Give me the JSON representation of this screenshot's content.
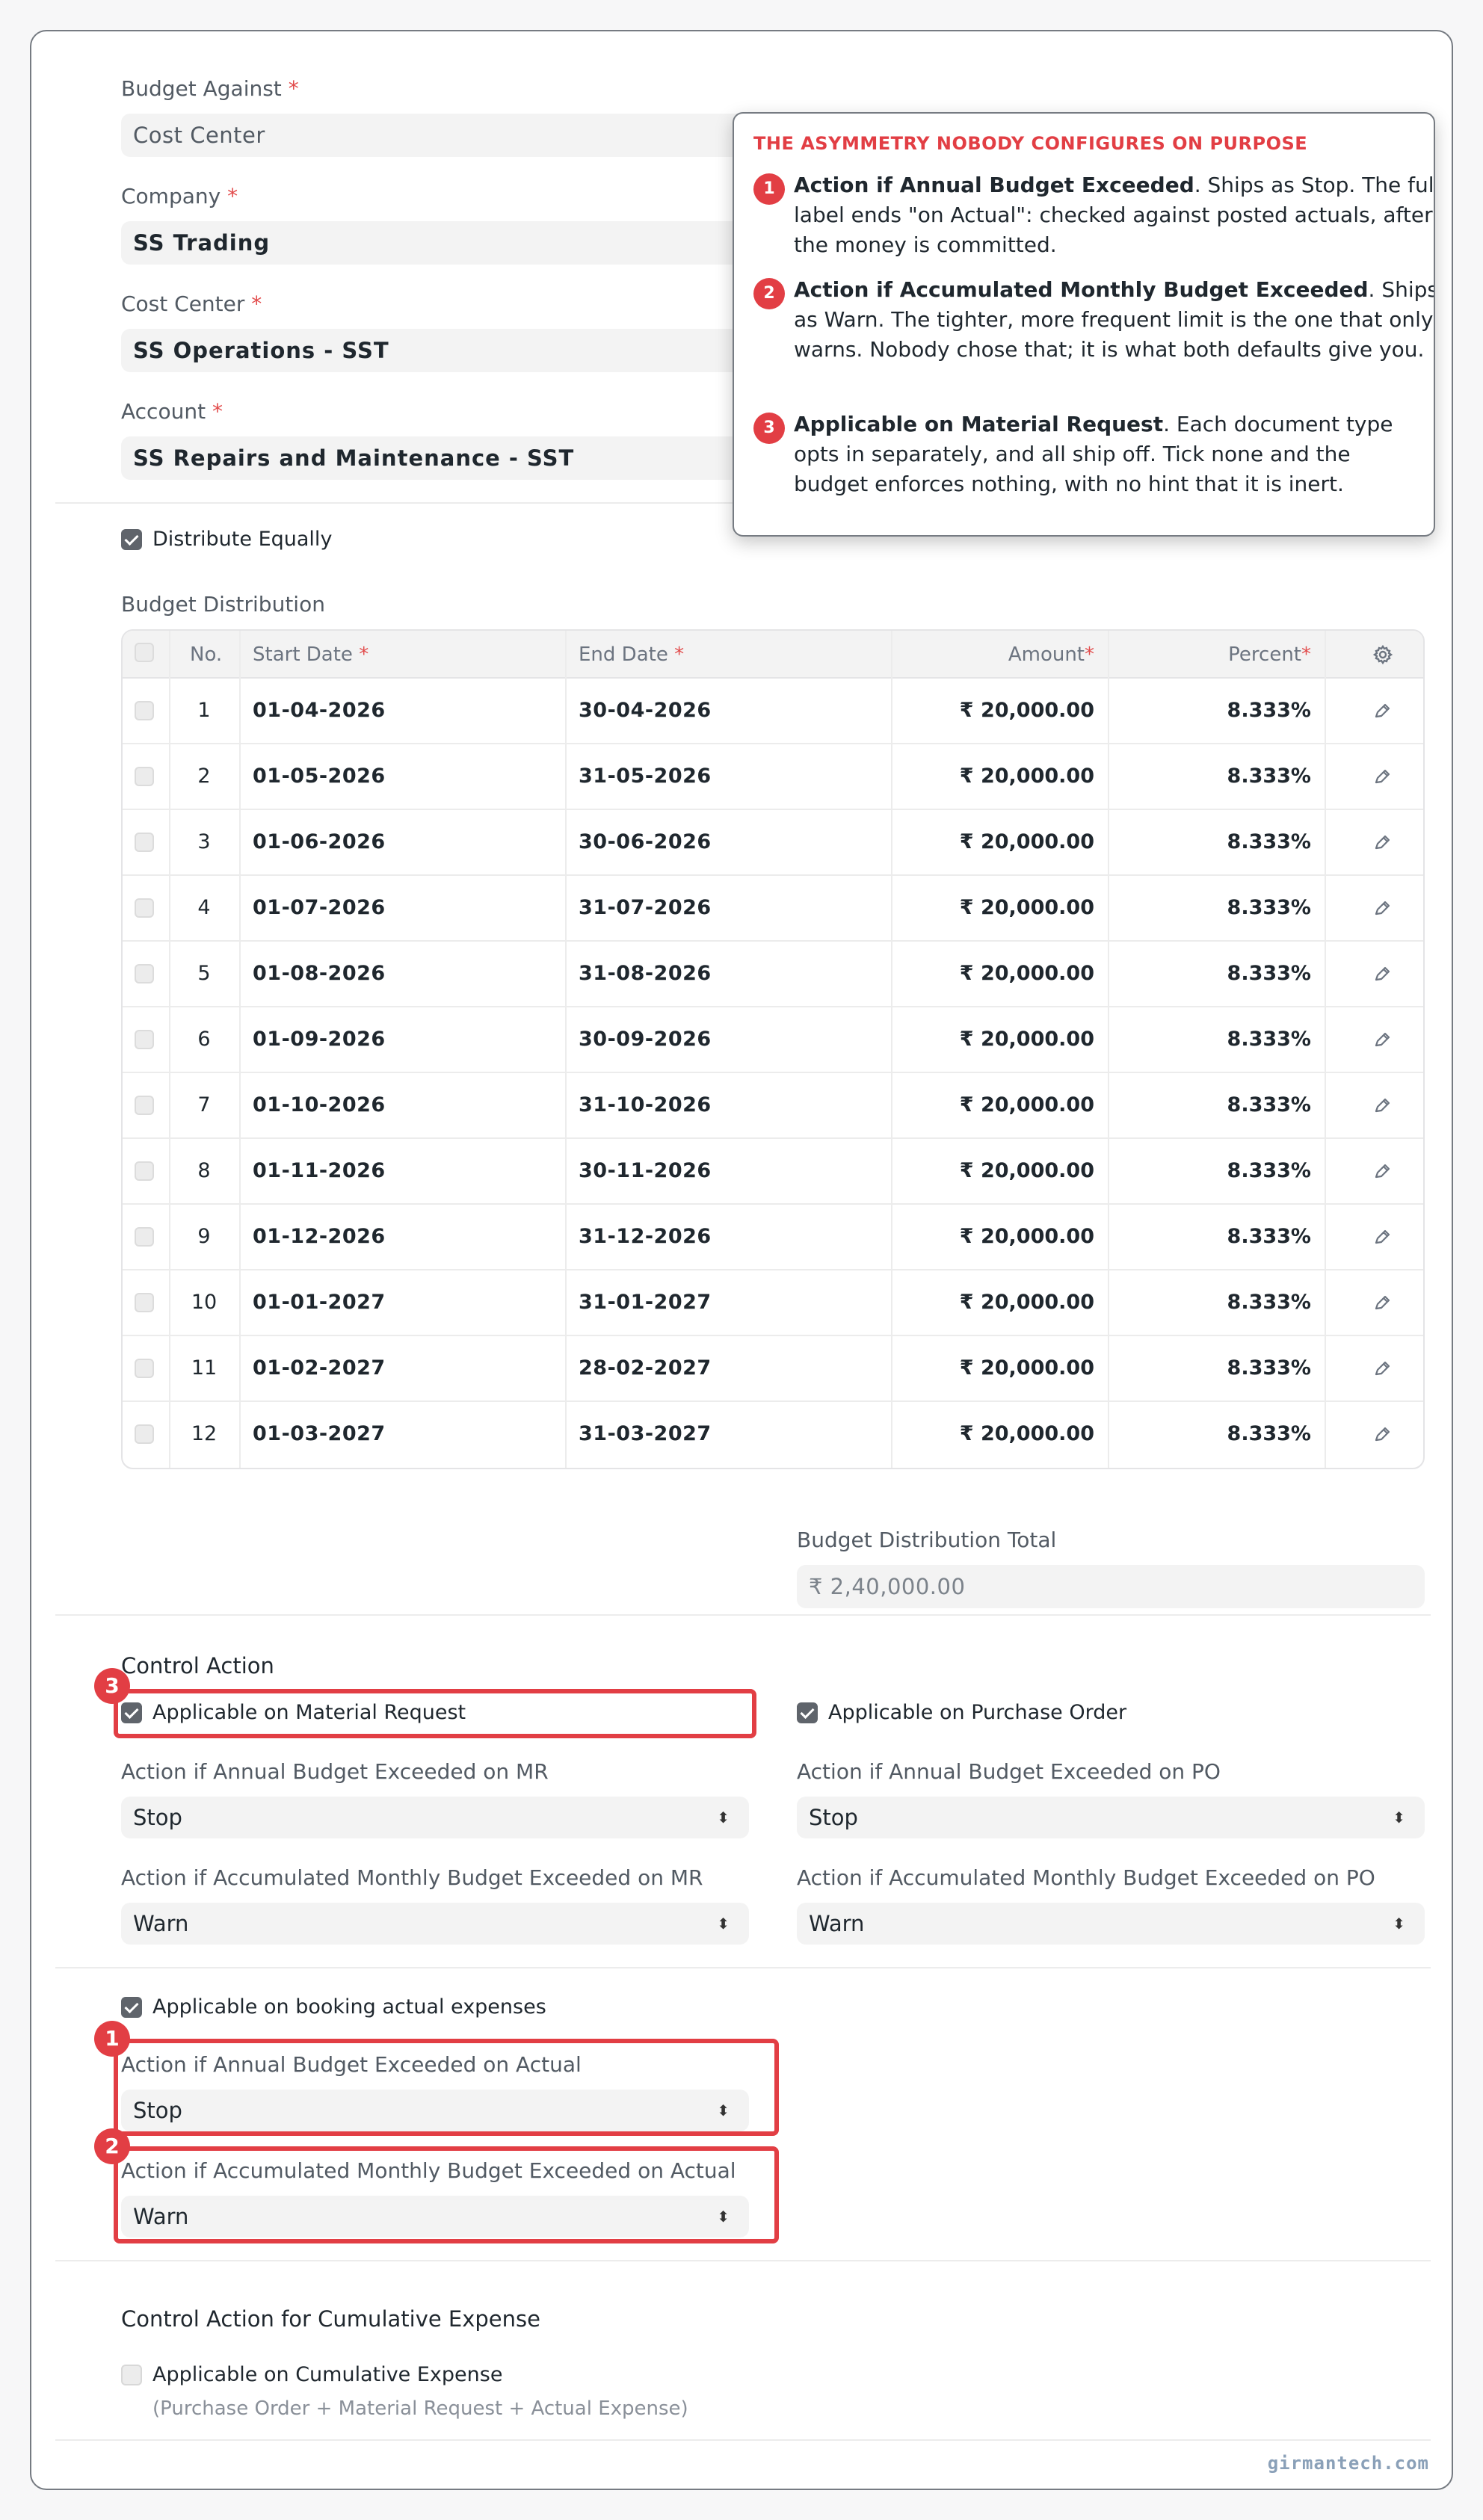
{
  "fields": {
    "budget_against": {
      "label": "Budget Against",
      "value": "Cost Center"
    },
    "company": {
      "label": "Company",
      "value": "SS Trading"
    },
    "cost_center": {
      "label": "Cost Center",
      "value": "SS Operations - SST"
    },
    "account": {
      "label": "Account",
      "value": "SS Repairs and Maintenance - SST"
    },
    "required_mark": "*"
  },
  "distribute_equally": {
    "label": "Distribute Equally",
    "checked": true
  },
  "budget_distribution": {
    "title": "Budget Distribution",
    "columns": {
      "no": "No.",
      "start_date": "Start Date",
      "end_date": "End Date",
      "amount": "Amount",
      "percent": "Percent"
    },
    "rows": [
      {
        "no": "1",
        "start": "01-04-2026",
        "end": "30-04-2026",
        "amount": "₹ 20,000.00",
        "percent": "8.333%"
      },
      {
        "no": "2",
        "start": "01-05-2026",
        "end": "31-05-2026",
        "amount": "₹ 20,000.00",
        "percent": "8.333%"
      },
      {
        "no": "3",
        "start": "01-06-2026",
        "end": "30-06-2026",
        "amount": "₹ 20,000.00",
        "percent": "8.333%"
      },
      {
        "no": "4",
        "start": "01-07-2026",
        "end": "31-07-2026",
        "amount": "₹ 20,000.00",
        "percent": "8.333%"
      },
      {
        "no": "5",
        "start": "01-08-2026",
        "end": "31-08-2026",
        "amount": "₹ 20,000.00",
        "percent": "8.333%"
      },
      {
        "no": "6",
        "start": "01-09-2026",
        "end": "30-09-2026",
        "amount": "₹ 20,000.00",
        "percent": "8.333%"
      },
      {
        "no": "7",
        "start": "01-10-2026",
        "end": "31-10-2026",
        "amount": "₹ 20,000.00",
        "percent": "8.333%"
      },
      {
        "no": "8",
        "start": "01-11-2026",
        "end": "30-11-2026",
        "amount": "₹ 20,000.00",
        "percent": "8.333%"
      },
      {
        "no": "9",
        "start": "01-12-2026",
        "end": "31-12-2026",
        "amount": "₹ 20,000.00",
        "percent": "8.333%"
      },
      {
        "no": "10",
        "start": "01-01-2027",
        "end": "31-01-2027",
        "amount": "₹ 20,000.00",
        "percent": "8.333%"
      },
      {
        "no": "11",
        "start": "01-02-2027",
        "end": "28-02-2027",
        "amount": "₹ 20,000.00",
        "percent": "8.333%"
      },
      {
        "no": "12",
        "start": "01-03-2027",
        "end": "31-03-2027",
        "amount": "₹ 20,000.00",
        "percent": "8.333%"
      }
    ],
    "total_label": "Budget Distribution Total",
    "total_value": "₹ 2,40,000.00"
  },
  "control_action": {
    "title": "Control Action",
    "mr_checkbox": {
      "label": "Applicable on Material Request",
      "checked": true
    },
    "po_checkbox": {
      "label": "Applicable on Purchase Order",
      "checked": true
    },
    "annual_mr": {
      "label": "Action if Annual Budget Exceeded on MR",
      "value": "Stop"
    },
    "annual_po": {
      "label": "Action if Annual Budget Exceeded on PO",
      "value": "Stop"
    },
    "monthly_mr": {
      "label": "Action if Accumulated Monthly Budget Exceeded on MR",
      "value": "Warn"
    },
    "monthly_po": {
      "label": "Action if Accumulated Monthly Budget Exceeded on PO",
      "value": "Warn"
    },
    "actual_checkbox": {
      "label": "Applicable on booking actual expenses",
      "checked": true
    },
    "annual_actual": {
      "label": "Action if Annual Budget Exceeded on Actual",
      "value": "Stop"
    },
    "monthly_actual": {
      "label": "Action if Accumulated Monthly Budget Exceeded on Actual",
      "value": "Warn"
    }
  },
  "cumulative": {
    "title": "Control Action for Cumulative Expense",
    "checkbox_label": "Applicable on Cumulative Expense",
    "checked": false,
    "hint": "(Purchase Order + Material Request + Actual Expense)"
  },
  "callout": {
    "title": "THE ASYMMETRY NOBODY CONFIGURES ON PURPOSE",
    "items": [
      {
        "num": "1",
        "bold": "Action if Annual Budget Exceeded",
        "text": ". Ships as Stop. The full label ends \"on Actual\": checked against posted actuals, after the money is committed."
      },
      {
        "num": "2",
        "bold": "Action if Accumulated Monthly Budget Exceeded",
        "text": ". Ships as Warn. The tighter, more frequent limit is the one that only warns. Nobody chose that; it is what both defaults give you."
      },
      {
        "num": "3",
        "bold": "Applicable on Material Request",
        "text": ". Each document type opts in separately, and all ship off. Tick none and the budget enforces nothing, with no hint that it is inert."
      }
    ]
  },
  "annotation_badges": {
    "one": "1",
    "two": "2",
    "three": "3"
  },
  "colors": {
    "highlight": "#e23e44",
    "checkbox": "#5f646b",
    "field_bg": "#f3f3f3"
  },
  "watermark": "girmantech.com"
}
